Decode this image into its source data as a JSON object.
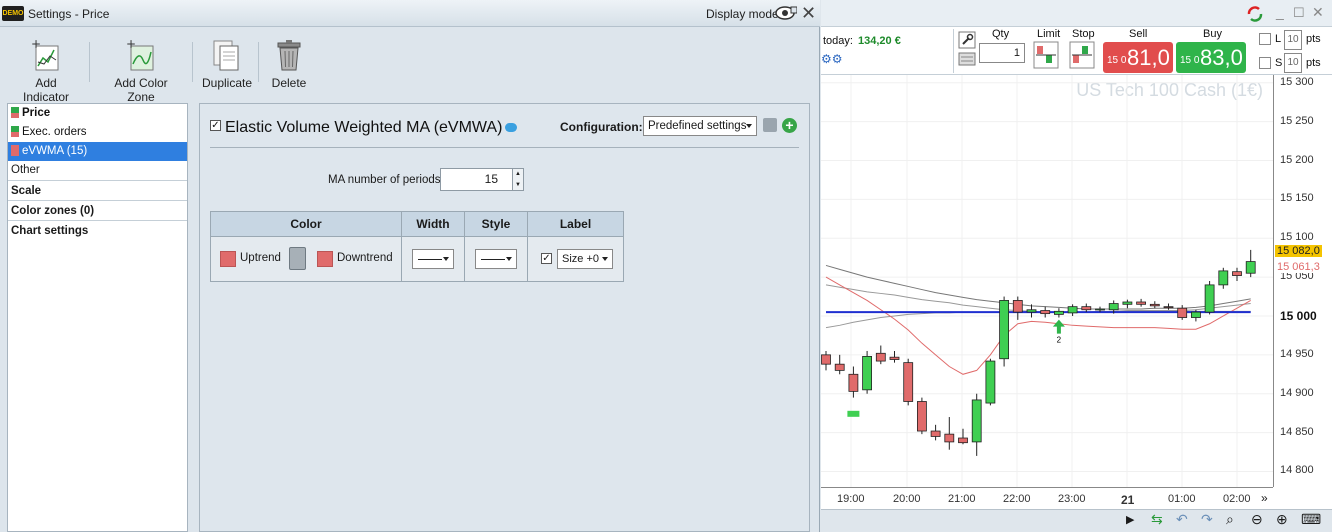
{
  "dialog": {
    "badge": "DEMO",
    "title": "Settings - Price",
    "display_mode": "Display mode",
    "close": "✕"
  },
  "toolbar": {
    "add_indicator": "Add Indicator",
    "add_color_zone": "Add Color Zone",
    "duplicate": "Duplicate",
    "delete": "Delete"
  },
  "tree": {
    "price": "Price",
    "exec_orders": "Exec. orders",
    "evwma": "eVWMA (15)",
    "other": "Other",
    "scale": "Scale",
    "color_zones": "Color zones (0)",
    "chart_settings": "Chart settings"
  },
  "panel": {
    "checked": "✓",
    "indicator_title": "Elastic Volume Weighted MA (eVMWA)",
    "configuration_label": "Configuration:",
    "configuration_value": "Predefined settings",
    "ma_label": "MA number of periods",
    "ma_value": "15",
    "table": {
      "headers": [
        "Color",
        "Width",
        "Style",
        "Label"
      ],
      "uptrend": "Uptrend",
      "downtrend": "Downtrend",
      "label_size": "Size +0"
    }
  },
  "trading": {
    "today_label": "today:",
    "today_value": "134,20 €",
    "qty_label": "Qty",
    "qty_value": "1",
    "limit_label": "Limit",
    "stop_label": "Stop",
    "sell_label": "Sell",
    "buy_label": "Buy",
    "sell_small": "15 0",
    "sell_big": "81,0",
    "buy_small": "15 0",
    "buy_big": "83,0",
    "l_label": "L",
    "s_label": "S",
    "pts_value": "10",
    "pts_label": "pts",
    "instrument": "US Tech 100 Cash (1€)"
  },
  "chart_data": {
    "type": "candlestick",
    "title": "US Tech 100 Cash (1€)",
    "yticks": [
      "15 300",
      "15 250",
      "15 200",
      "15 150",
      "15 100",
      "15 050",
      "15 000",
      "14 950",
      "14 900",
      "14 850",
      "14 800"
    ],
    "xticks": [
      "19:00",
      "20:00",
      "21:00",
      "22:00",
      "23:00",
      "21",
      "01:00",
      "02:00"
    ],
    "price_tags": [
      "15 082,0",
      "15 061,3"
    ],
    "marker_label": "2",
    "ylim": [
      14780,
      15310
    ],
    "candles": [
      {
        "o": 14950,
        "h": 14955,
        "l": 14930,
        "c": 14938,
        "up": false
      },
      {
        "o": 14938,
        "h": 14950,
        "l": 14925,
        "c": 14930,
        "up": false
      },
      {
        "o": 14925,
        "h": 14935,
        "l": 14895,
        "c": 14903,
        "up": false
      },
      {
        "o": 14905,
        "h": 14955,
        "l": 14900,
        "c": 14948,
        "up": true
      },
      {
        "o": 14952,
        "h": 14962,
        "l": 14938,
        "c": 14942,
        "up": false
      },
      {
        "o": 14947,
        "h": 14955,
        "l": 14940,
        "c": 14944,
        "up": false
      },
      {
        "o": 14940,
        "h": 14945,
        "l": 14885,
        "c": 14890,
        "up": false
      },
      {
        "o": 14890,
        "h": 14895,
        "l": 14848,
        "c": 14852,
        "up": false
      },
      {
        "o": 14852,
        "h": 14860,
        "l": 14840,
        "c": 14845,
        "up": false
      },
      {
        "o": 14848,
        "h": 14870,
        "l": 14828,
        "c": 14838,
        "up": false
      },
      {
        "o": 14843,
        "h": 14855,
        "l": 14835,
        "c": 14837,
        "up": false
      },
      {
        "o": 14838,
        "h": 14900,
        "l": 14820,
        "c": 14892,
        "up": true
      },
      {
        "o": 14888,
        "h": 14945,
        "l": 14885,
        "c": 14942,
        "up": true
      },
      {
        "o": 14945,
        "h": 15025,
        "l": 14935,
        "c": 15020,
        "up": true
      },
      {
        "o": 15020,
        "h": 15025,
        "l": 14995,
        "c": 15005,
        "up": false
      },
      {
        "o": 15005,
        "h": 15015,
        "l": 14998,
        "c": 15008,
        "up": true
      },
      {
        "o": 15007,
        "h": 15012,
        "l": 14998,
        "c": 15003,
        "up": false
      },
      {
        "o": 15002,
        "h": 15010,
        "l": 14998,
        "c": 15006,
        "up": true
      },
      {
        "o": 15004,
        "h": 15015,
        "l": 15000,
        "c": 15012,
        "up": true
      },
      {
        "o": 15012,
        "h": 15016,
        "l": 15005,
        "c": 15008,
        "up": false
      },
      {
        "o": 15008,
        "h": 15012,
        "l": 15005,
        "c": 15009,
        "up": true
      },
      {
        "o": 15008,
        "h": 15020,
        "l": 15003,
        "c": 15016,
        "up": true
      },
      {
        "o": 15015,
        "h": 15021,
        "l": 15010,
        "c": 15018,
        "up": true
      },
      {
        "o": 15018,
        "h": 15022,
        "l": 15012,
        "c": 15015,
        "up": false
      },
      {
        "o": 15015,
        "h": 15019,
        "l": 15010,
        "c": 15013,
        "up": false
      },
      {
        "o": 15012,
        "h": 15016,
        "l": 15008,
        "c": 15011,
        "up": false
      },
      {
        "o": 15010,
        "h": 15014,
        "l": 14995,
        "c": 14998,
        "up": false
      },
      {
        "o": 14998,
        "h": 15008,
        "l": 14993,
        "c": 15005,
        "up": true
      },
      {
        "o": 15005,
        "h": 15045,
        "l": 15002,
        "c": 15040,
        "up": true
      },
      {
        "o": 15040,
        "h": 15062,
        "l": 15035,
        "c": 15058,
        "up": true
      },
      {
        "o": 15057,
        "h": 15062,
        "l": 15045,
        "c": 15052,
        "up": false
      },
      {
        "o": 15055,
        "h": 15085,
        "l": 15050,
        "c": 15070,
        "up": true
      }
    ],
    "lines": [
      {
        "name": "",
        "color": "#777777",
        "values": [
          15065,
          15060,
          15055,
          15050,
          15046,
          15042,
          15038,
          15034,
          15030,
          15027,
          15024,
          15021,
          15019,
          15017,
          15015,
          15013,
          15012,
          15011,
          15010,
          15009,
          15009,
          15009,
          15009,
          15009,
          15010,
          15010,
          15010,
          15011,
          15013,
          15016,
          15019,
          15022
        ]
      },
      {
        "name": "",
        "color": "#999999",
        "values": [
          15040,
          15037,
          15034,
          15031,
          15029,
          15027,
          15024,
          15021,
          15019,
          15017,
          15014,
          15012,
          15010,
          15008,
          15007,
          15006,
          15005,
          15005,
          15005,
          15005,
          15006,
          15006,
          15007,
          15007,
          15007,
          15007,
          15007,
          15008,
          15010,
          15012,
          15014,
          15016
        ]
      },
      {
        "name": "",
        "color": "#999999",
        "values": [
          14985,
          14988,
          14992,
          14995,
          14998,
          15000,
          15002,
          15003,
          15004,
          15004,
          15005,
          15005,
          15005,
          15005,
          15005,
          15005,
          15005,
          15005,
          15005,
          15005,
          15005,
          15006,
          15006,
          15006,
          15006,
          15006,
          15006,
          15006,
          15006,
          15006,
          15006,
          15006
        ]
      },
      {
        "name": "",
        "color": "#e06b6b",
        "values": [
          15050,
          15040,
          15030,
          15020,
          15008,
          14996,
          14982,
          14965,
          14950,
          14935,
          14925,
          14930,
          14950,
          14975,
          14990,
          14993,
          14992,
          14990,
          14988,
          14987,
          14986,
          14985,
          14985,
          14985,
          14985,
          14984,
          14983,
          14983,
          14990,
          15000,
          15010,
          15020
        ]
      },
      {
        "name": "",
        "color": "#1f2fd0",
        "values": [
          15005,
          15005,
          15005,
          15005,
          15005,
          15005,
          15005,
          15005,
          15005,
          15005,
          15005,
          15005,
          15005,
          15005,
          15005,
          15005,
          15005,
          15005,
          15005,
          15005,
          15005,
          15005,
          15005,
          15005,
          15005,
          15005,
          15005,
          15005,
          15005,
          15005,
          15005,
          15005
        ]
      }
    ],
    "markers": [
      {
        "candle": 17,
        "price": 14985,
        "dir": "up"
      }
    ]
  }
}
